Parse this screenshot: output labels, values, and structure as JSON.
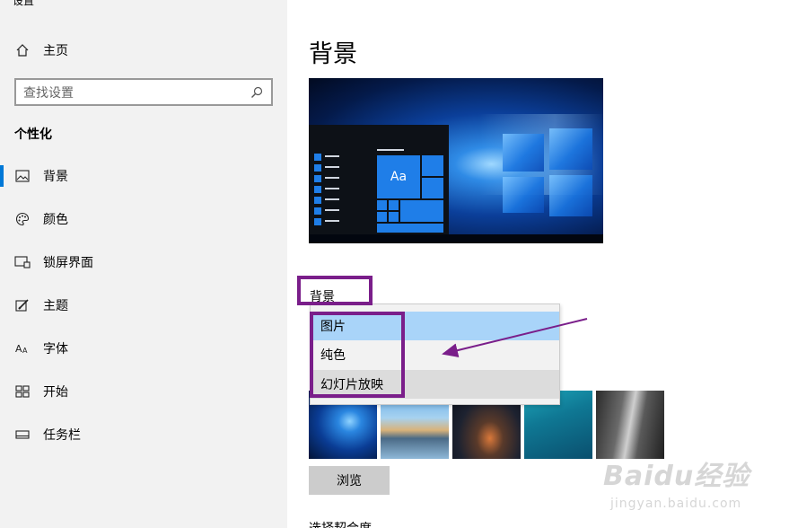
{
  "window": {
    "title": "设置"
  },
  "sidebar": {
    "home": {
      "label": "主页",
      "icon": "home-icon"
    },
    "search": {
      "placeholder": "查找设置",
      "icon": "search-icon"
    },
    "section_title": "个性化",
    "items": [
      {
        "label": "背景",
        "icon": "image-icon",
        "active": true
      },
      {
        "label": "颜色",
        "icon": "palette-icon",
        "active": false
      },
      {
        "label": "锁屏界面",
        "icon": "lock-screen-icon",
        "active": false
      },
      {
        "label": "主题",
        "icon": "theme-brush-icon",
        "active": false
      },
      {
        "label": "字体",
        "icon": "font-icon",
        "active": false
      },
      {
        "label": "开始",
        "icon": "start-grid-icon",
        "active": false
      },
      {
        "label": "任务栏",
        "icon": "taskbar-icon",
        "active": false
      }
    ]
  },
  "main": {
    "title": "背景",
    "preview": {
      "tile_label": "Aa"
    },
    "background_label": "背景",
    "dropdown": {
      "options": [
        "图片",
        "纯色",
        "幻灯片放映"
      ],
      "selected": "图片",
      "hovered": "幻灯片放映"
    },
    "browse_label": "浏览",
    "fit_label": "选择契合度"
  },
  "watermark": {
    "logo": "Baidu经验",
    "url": "jingyan.baidu.com"
  },
  "colors": {
    "accent": "#0078d7",
    "annotation": "#7a1e8a",
    "selected": "#a9d4f9"
  }
}
